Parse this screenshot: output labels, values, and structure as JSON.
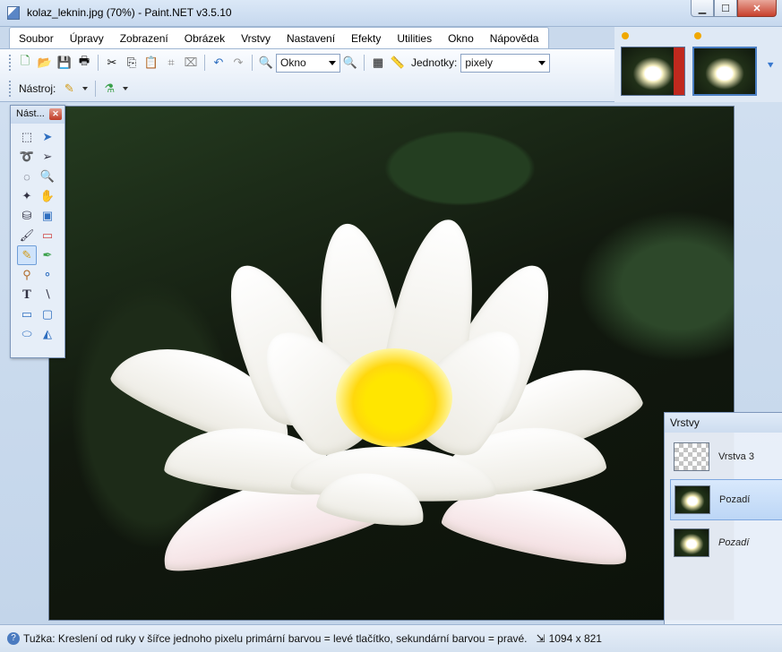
{
  "window": {
    "title": "kolaz_leknin.jpg (70%) - Paint.NET v3.5.10",
    "minimize_icon": "minimize-icon",
    "maximize_icon": "maximize-icon",
    "close_icon": "close-icon"
  },
  "menu": {
    "items": [
      "Soubor",
      "Úpravy",
      "Zobrazení",
      "Obrázek",
      "Vrstvy",
      "Nastavení",
      "Efekty",
      "Utilities",
      "Okno",
      "Nápověda"
    ]
  },
  "toolbar": {
    "zoom_value": "Okno",
    "units_label": "Jednotky:",
    "units_value": "pixely",
    "tool_label": "Nástroj:"
  },
  "tools_window": {
    "title": "Nást...",
    "tools": [
      "rectangle-select-icon",
      "move-selection-icon",
      "lasso-select-icon",
      "move-selected-icon",
      "ellipse-select-icon",
      "zoom-icon",
      "magic-wand-icon",
      "pan-icon",
      "paint-bucket-icon",
      "gradient-icon",
      "paintbrush-icon",
      "eraser-icon",
      "pencil-icon",
      "color-picker-icon",
      "clone-stamp-icon",
      "recolor-icon",
      "text-icon",
      "line-curve-icon",
      "rectangle-icon",
      "rounded-rectangle-icon",
      "ellipse-icon",
      "freeform-shape-icon"
    ],
    "active_tool": "pencil-icon"
  },
  "layers_window": {
    "title": "Vrstvy",
    "layers": [
      {
        "name": "Vrstva 3",
        "selected": false,
        "italic": false
      },
      {
        "name": "Pozadí",
        "selected": true,
        "italic": false
      },
      {
        "name": "Pozadí",
        "selected": false,
        "italic": true
      }
    ]
  },
  "status": {
    "text": "Tužka: Kreslení od ruky v šířce jednoho pixelu primární barvou = levé tlačítko, sekundární barvou = pravé.",
    "image_size": "1094 x 821"
  },
  "colors": {
    "accent": "#3878cf",
    "flower_yellow": "#ffe600"
  }
}
